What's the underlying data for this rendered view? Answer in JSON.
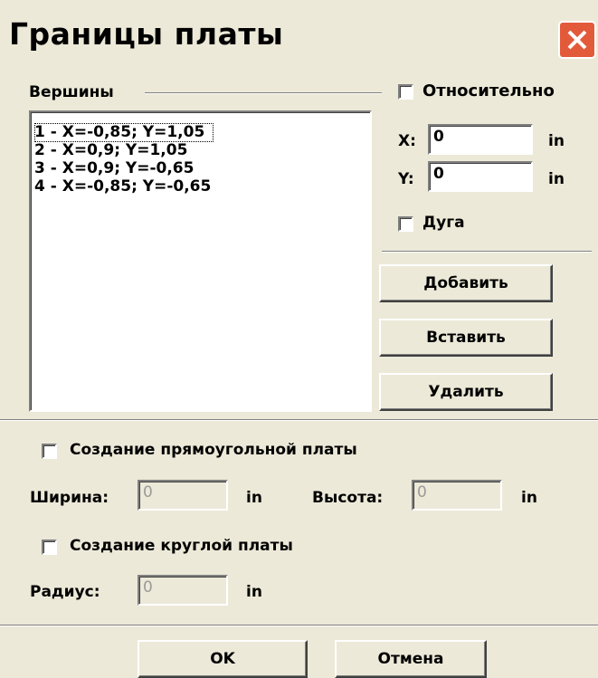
{
  "window": {
    "title": "Границы платы"
  },
  "vertices": {
    "group_label": "Вершины",
    "items": [
      "1  -  X=-0,85;  Y=1,05",
      "2  -  X=0,9;  Y=1,05",
      "3  -  X=0,9;  Y=-0,65",
      "4  -  X=-0,85;  Y=-0,65"
    ]
  },
  "relative": {
    "label": "Относительно",
    "checked": false
  },
  "x": {
    "label": "X:",
    "value": "0",
    "unit": "in"
  },
  "y": {
    "label": "Y:",
    "value": "0",
    "unit": "in"
  },
  "arc": {
    "label": "Дуга",
    "checked": false
  },
  "buttons": {
    "add": "Добавить",
    "insert": "Вставить",
    "delete": "Удалить",
    "ok": "OK",
    "cancel": "Отмена"
  },
  "rect_board": {
    "label": "Создание прямоугольной платы",
    "checked": false,
    "width_label": "Ширина:",
    "width_value": "0",
    "width_unit": "in",
    "height_label": "Высота:",
    "height_value": "0",
    "height_unit": "in"
  },
  "round_board": {
    "label": "Создание круглой платы",
    "checked": false,
    "radius_label": "Радиус:",
    "radius_value": "0",
    "radius_unit": "in"
  },
  "colors": {
    "close_button": "#e35a3a",
    "dialog_bg": "#ece9d8"
  },
  "icons": {
    "close": "close-icon"
  }
}
